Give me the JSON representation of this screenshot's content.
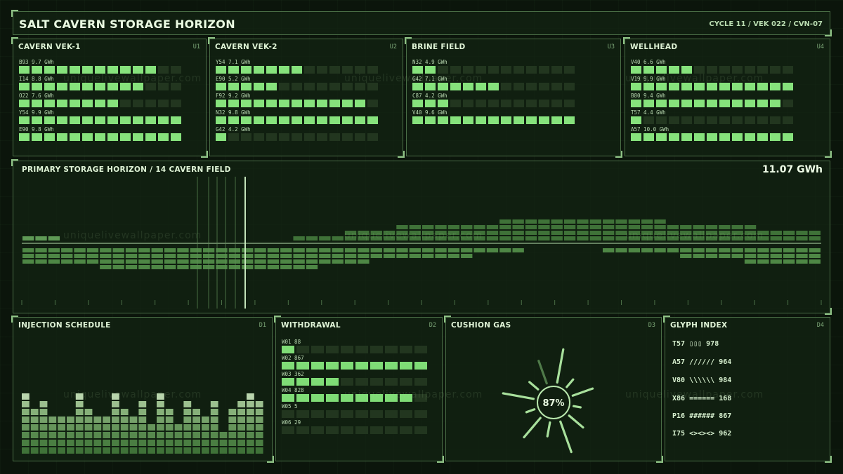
{
  "header": {
    "title": "SALT CAVERN STORAGE HORIZON",
    "meta": "CYCLE 11 / VEK 022 / CVN-07"
  },
  "top_panels": [
    {
      "title": "CAVERN VEK-1",
      "code": "U1",
      "rows": [
        {
          "label": "B93  9.7 GWh",
          "on": 11
        },
        {
          "label": "I14  8.8 GWh",
          "on": 10
        },
        {
          "label": "O22  7.6 GWh",
          "on": 8
        },
        {
          "label": "Y54  9.9 GWh",
          "on": 13
        },
        {
          "label": "E90  9.8 GWh",
          "on": 13
        }
      ]
    },
    {
      "title": "CAVERN VEK-2",
      "code": "U2",
      "rows": [
        {
          "label": "Y54  7.1 GWh",
          "on": 7
        },
        {
          "label": "E90  5.2 GWh",
          "on": 5
        },
        {
          "label": "F92  9.2 GWh",
          "on": 12
        },
        {
          "label": "N32  9.8 GWh",
          "on": 13
        },
        {
          "label": "G42  4.2 GWh",
          "on": 1
        }
      ]
    },
    {
      "title": "BRINE FIELD",
      "code": "U3",
      "rows": [
        {
          "label": "N32  4.9 GWh",
          "on": 2
        },
        {
          "label": "G42  7.1 GWh",
          "on": 7
        },
        {
          "label": "C87  4.2 GWh",
          "on": 3
        },
        {
          "label": "V40  9.6 GWh",
          "on": 13
        }
      ]
    },
    {
      "title": "WELLHEAD",
      "code": "U4",
      "rows": [
        {
          "label": "V40  6.6 GWh",
          "on": 5
        },
        {
          "label": "V19  9.9 GWh",
          "on": 13
        },
        {
          "label": "B80  9.4 GWh",
          "on": 12
        },
        {
          "label": "T57  4.4 GWh",
          "on": 1
        },
        {
          "label": "A57  10.0 GWh",
          "on": 13
        }
      ]
    }
  ],
  "hero": {
    "title": "PRIMARY STORAGE HORIZON / 14 CAVERN FIELD",
    "value": "11.07 GWh"
  },
  "hero_data": {
    "upper": [
      1,
      1,
      1,
      0,
      0,
      0,
      0,
      0,
      0,
      0,
      0,
      0,
      0,
      0,
      0,
      0,
      0,
      0,
      0,
      0,
      0,
      1,
      1,
      1,
      1,
      2,
      2,
      2,
      2,
      3,
      3,
      3,
      3,
      3,
      3,
      3,
      3,
      4,
      4,
      4,
      4,
      4,
      4,
      4,
      4,
      4,
      4,
      4,
      4,
      4,
      3,
      3,
      3,
      3,
      3,
      3,
      3,
      2,
      2,
      2,
      2,
      2
    ],
    "lower": [
      3,
      3,
      3,
      3,
      3,
      3,
      4,
      4,
      4,
      4,
      4,
      4,
      4,
      4,
      4,
      4,
      4,
      4,
      4,
      4,
      4,
      4,
      4,
      3,
      3,
      3,
      3,
      2,
      2,
      2,
      2,
      2,
      2,
      2,
      2,
      1,
      1,
      1,
      1,
      0,
      0,
      0,
      0,
      0,
      0,
      1,
      1,
      1,
      1,
      1,
      1,
      2,
      2,
      2,
      2,
      2,
      3,
      3,
      3,
      3,
      3,
      3
    ]
  },
  "injection": {
    "title": "INJECTION SCHEDULE",
    "code": "D1",
    "heights": [
      8,
      6,
      7,
      5,
      5,
      5,
      8,
      6,
      5,
      5,
      8,
      6,
      5,
      7,
      4,
      8,
      6,
      4,
      7,
      6,
      5,
      7,
      3,
      6,
      7,
      8,
      7
    ]
  },
  "withdrawal": {
    "title": "WITHDRAWAL",
    "code": "D2",
    "rows": [
      {
        "label": "W01 88",
        "on": 1
      },
      {
        "label": "W02 867",
        "on": 10
      },
      {
        "label": "W03 362",
        "on": 4
      },
      {
        "label": "W04 828",
        "on": 9
      },
      {
        "label": "W05 5",
        "on": 0
      },
      {
        "label": "W06 29",
        "on": 0
      }
    ]
  },
  "cushion": {
    "title": "CUSHION GAS",
    "code": "D3",
    "value": "87%",
    "fraction": 0.87
  },
  "glyph": {
    "title": "GLYPH INDEX",
    "code": "D4",
    "lines": [
      "T57 ▯▯▯ 978",
      "A57 ////// 964",
      "V80 \\\\\\\\\\\\ 984",
      "X86 ====== 168",
      "P16 ###### 867",
      "I75 <><><> 962"
    ]
  },
  "watermark": "uniquelivewallpaper.com",
  "colors": {
    "accent": "#86e27c",
    "dim": "#22361f",
    "border": "#4a6e46"
  }
}
